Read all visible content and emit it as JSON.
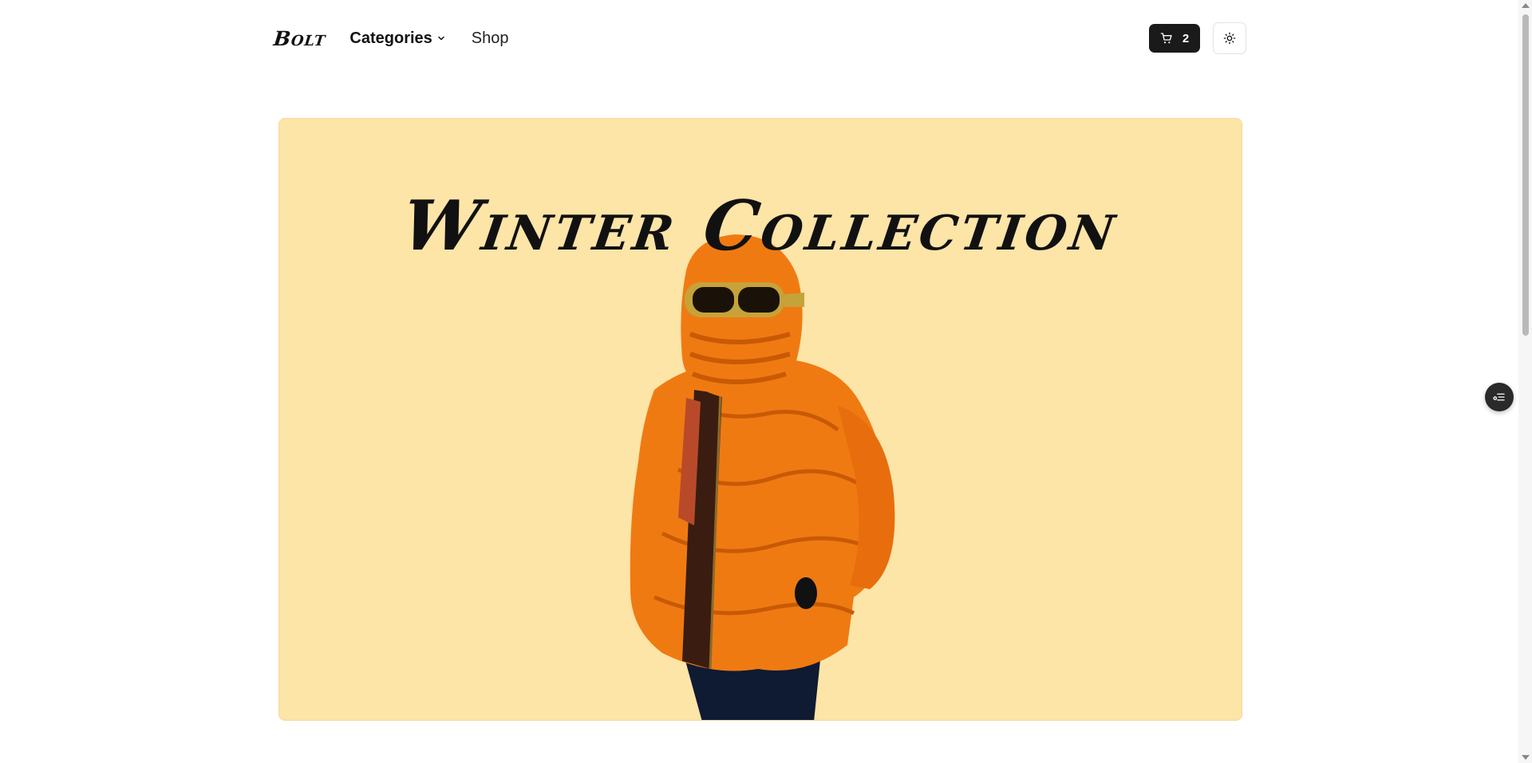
{
  "header": {
    "logo": "Bolt",
    "nav": {
      "categories_label": "Categories",
      "shop_label": "Shop"
    },
    "cart": {
      "count": "2",
      "icon": "cart-icon"
    },
    "theme_toggle": {
      "icon": "sun-icon"
    }
  },
  "hero": {
    "title": "Winter Collection",
    "background_color": "#fde4a7",
    "image_subject": "person-in-orange-puffer-jacket"
  },
  "floating_action": {
    "icon": "filter-settings-icon"
  },
  "colors": {
    "accent_dark": "#1a1a1a",
    "hero_bg": "#fde4a7",
    "jacket_orange": "#f07a12"
  }
}
